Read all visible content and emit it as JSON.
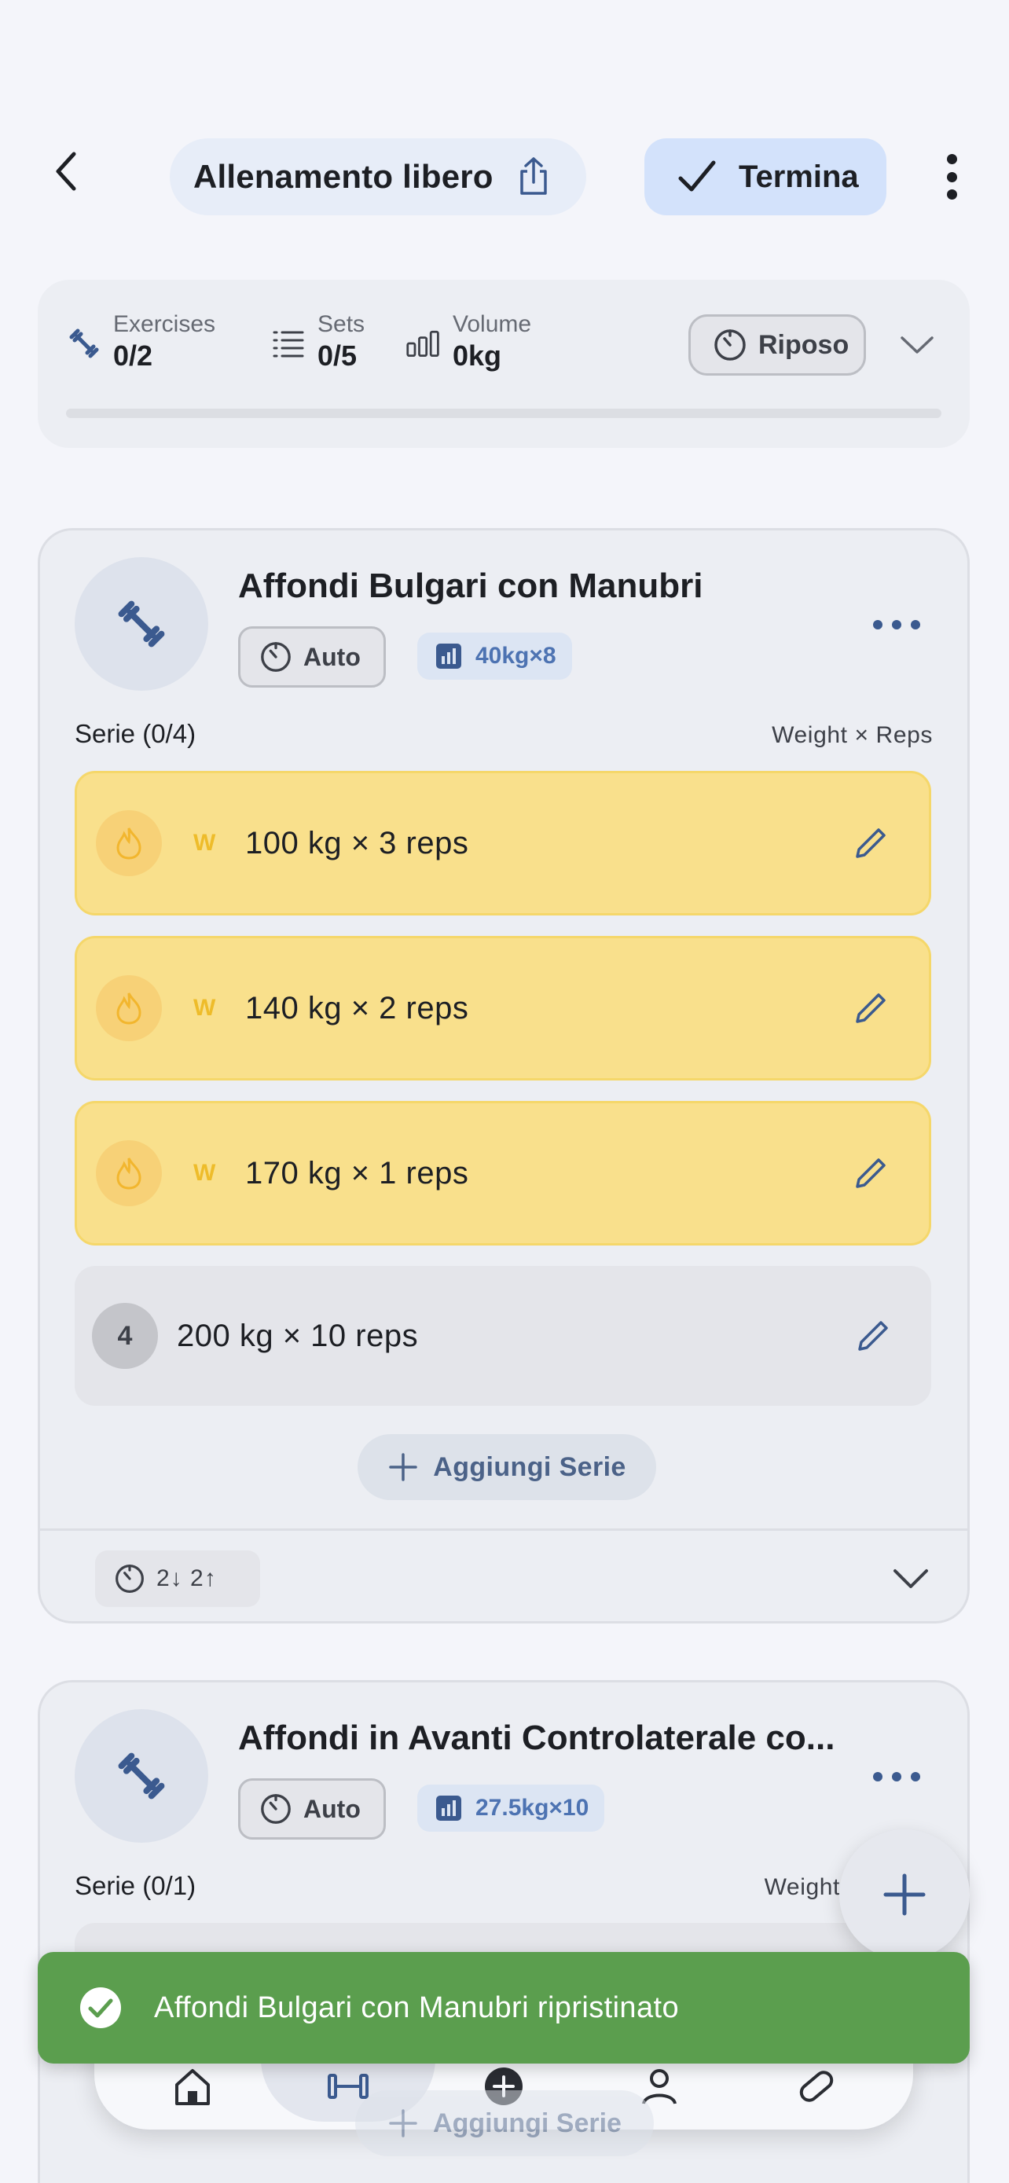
{
  "header": {
    "title": "Allenamento libero",
    "finish_label": "Termina"
  },
  "stats": {
    "exercises_caption": "Exercises",
    "exercises_value": "0/2",
    "sets_caption": "Sets",
    "sets_value": "0/5",
    "volume_caption": "Volume",
    "volume_value": "0kg",
    "rest_label": "Riposo",
    "progress": 0
  },
  "exercises": [
    {
      "name": "Affondi Bulgari con Manubri",
      "timer_mode": "Auto",
      "record": "40kg×8",
      "series_header": "Serie (0/4)",
      "column_header": "Weight × Reps",
      "sets": [
        {
          "type": "W",
          "text": "100 kg × 3 reps"
        },
        {
          "type": "W",
          "text": "140 kg × 2 reps"
        },
        {
          "type": "W",
          "text": "170 kg × 1 reps"
        },
        {
          "type": "4",
          "text": "200 kg × 10 reps"
        }
      ],
      "add_series_label": "Aggiungi Serie",
      "rest_summary": "2↓ 2↑"
    },
    {
      "name": "Affondi in Avanti Controlaterale co...",
      "timer_mode": "Auto",
      "record": "27.5kg×10",
      "series_header": "Serie (0/1)",
      "column_header": "Weight"
    }
  ],
  "ghost_add_label": "Aggiungi Serie",
  "snackbar": {
    "message": "Affondi Bulgari con Manubri ripristinato",
    "color": "#5b9e4e"
  },
  "colors": {
    "accent": "#3b5a8f",
    "warmup_bg": "#f9e08c",
    "finish_bg": "#d3e2fb"
  }
}
